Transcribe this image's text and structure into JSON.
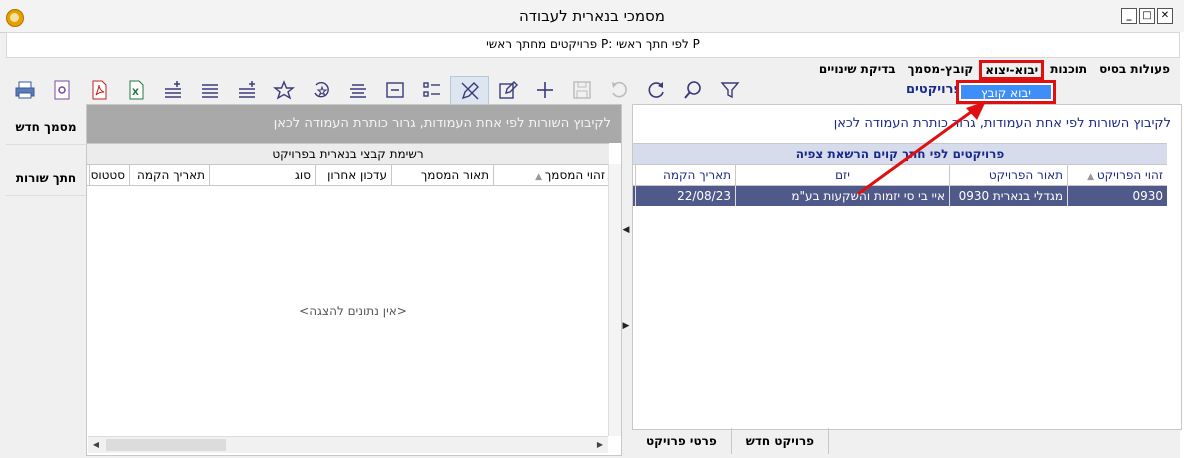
{
  "window": {
    "title": "מסמכי בנארית לעבודה",
    "subtitle": "פרויקטים מחתך ראשי P: לפי חתך ראשי P"
  },
  "menu": {
    "items": [
      "פעולות בסיס",
      "תוכנות",
      "יבוא-יצוא",
      "קובץ-מסמך",
      "בדיקת שינויים"
    ]
  },
  "popup": {
    "label": "יבוא קובץ"
  },
  "projects_label": "פרויקטים",
  "left_tabs": [
    "מסמך חדש",
    "חתך שורות"
  ],
  "left_panel": {
    "group_hint": "לקיבוץ השורות לפי אחת העמודות, גרור כותרת העמודה לכאן",
    "band": "רשימת קבצי בנארית בפרויקט",
    "columns": [
      "זהוי המסמך",
      "תאור המסמך",
      "עדכון אחרון",
      "סוג",
      "תאריך הקמה",
      "סטטוס"
    ],
    "empty": "<אין נתונים להצגה>"
  },
  "right_panel": {
    "group_hint": "לקיבוץ השורות לפי אחת העמודות, גרור כותרת העמודה לכאן",
    "band": "פרויקטים לפי חתך קוים הרשאת צפיה",
    "columns": [
      "זהוי הפרויקט",
      "תאור הפרויקט",
      "יזם",
      "תאריך הקמה"
    ],
    "rows": [
      [
        "0930",
        "מגדלי בנארית 0930",
        "איי בי סי יזמות והשקעות בע\"מ",
        "22/08/23"
      ]
    ]
  },
  "bottom_tabs": [
    "פרויקט חדש",
    "פרטי פרויקט"
  ],
  "colors": {
    "accent": "#3d8ef8",
    "highlight": "#e01010",
    "selected_row": "#505a8a",
    "band": "#d7dced"
  },
  "toolbar_icons": [
    "printer-icon",
    "preview-icon",
    "pdf-icon",
    "excel-icon",
    "add-row-icon",
    "align-icon",
    "sort-add-icon",
    "star-icon",
    "undo-star-icon",
    "list-icon",
    "frame-icon",
    "checklist-icon",
    "edit-disabled-icon",
    "edit-icon",
    "add-icon",
    "save-icon",
    "undo-icon",
    "refresh-icon",
    "search-icon",
    "filter-icon"
  ]
}
